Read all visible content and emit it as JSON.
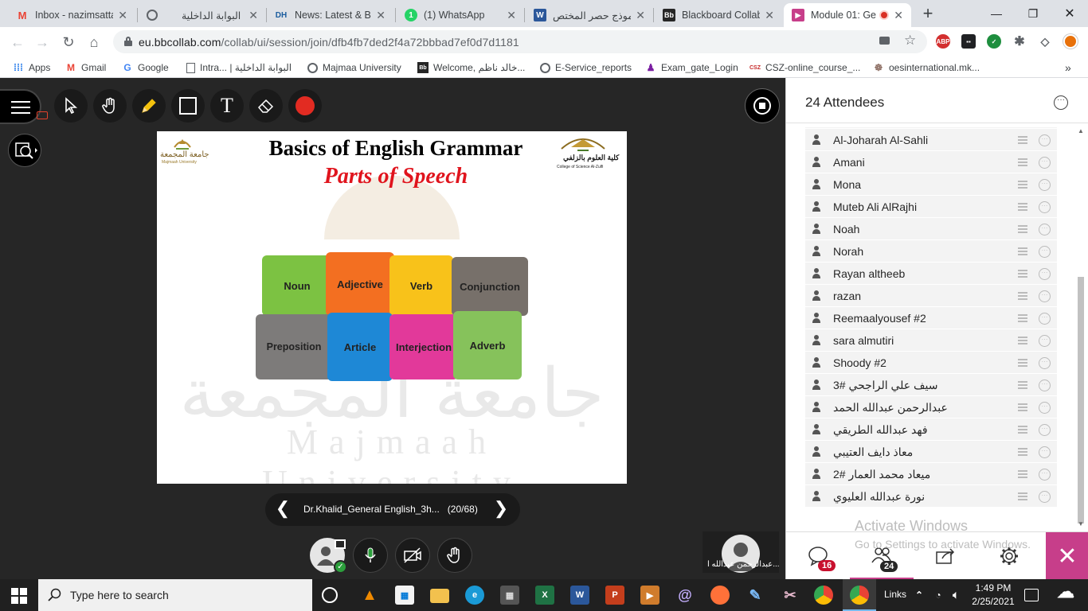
{
  "tabs": [
    {
      "label": "Inbox - nazimsatta",
      "icon": "gmail-icon"
    },
    {
      "label": "البوابة الداخلية",
      "icon": "globe-icon"
    },
    {
      "label": "News: Latest & Bre",
      "icon": "dh-icon"
    },
    {
      "label": "(1) WhatsApp",
      "icon": "whatsapp-icon"
    },
    {
      "label": "نموذج حصر المختص",
      "icon": "word-icon"
    },
    {
      "label": "Blackboard Collab",
      "icon": "bb-icon"
    },
    {
      "label": "Module 01: Ge",
      "icon": "collab-icon"
    }
  ],
  "address": {
    "host": "eu.bbcollab.com",
    "path": "/collab/ui/session/join/dfb4fb7ded2f4a72bbbad7ef0d7d1181"
  },
  "bookmarks": [
    "Apps",
    "Gmail",
    "Google",
    "Intra... | البوابة الداخلية",
    "Majmaa University",
    "Welcome, خالد ناظم...",
    "E-Service_reports",
    "Exam_gate_Login",
    "CSZ-online_course_...",
    "oesinternational.mk..."
  ],
  "slide": {
    "title": "Basics of English Grammar",
    "subtitle": "Parts of Speech",
    "logo_left_text": "جامعة المجمعة",
    "logo_left_sub": "Majmaah University",
    "logo_right_text": "كلية العلوم بالزلفي",
    "logo_right_sub": "College of Science Al-Zulfi",
    "watermark_ar": "جامعة المجمعة",
    "watermark_en": "Majmaah University",
    "pieces": [
      "Noun",
      "Adjective",
      "Verb",
      "Conjunction",
      "Preposition",
      "Article",
      "Interjection",
      "Adverb"
    ]
  },
  "file_nav": {
    "name": "Dr.Khalid_General English_3h...",
    "page": "(20/68)"
  },
  "video": {
    "name": "عبدالرحمن عبدالله ا..."
  },
  "panel": {
    "title": "24 Attendees",
    "attendees": [
      "Al-Joharah Al-Sahli",
      "Amani",
      "Mona",
      "Muteb Ali AlRajhi",
      "Noah",
      "Norah",
      "Rayan altheeb",
      "razan",
      "Reemaalyousef #2",
      "sara almutiri",
      "Shoody #2",
      "سيف علي الراجحي #3",
      "عبدالرحمن عبدالله الحمد",
      "فهد عبدالله الطريقي",
      "معاذ دايف العتيبي",
      "ميعاد محمد العمار #2",
      "نورة عبدالله العليوي"
    ],
    "activate_title": "Activate Windows",
    "activate_sub": "Go to Settings to activate Windows.",
    "chat_badge": "16",
    "attendees_badge": "24"
  },
  "taskbar": {
    "search_placeholder": "Type here to search",
    "links": "Links",
    "time": "1:49 PM",
    "date": "2/25/2021"
  },
  "colors": {
    "collab_accent": "#c73e8a",
    "badge_red": "#c8102e",
    "slide_subtitle": "#e0141d"
  }
}
